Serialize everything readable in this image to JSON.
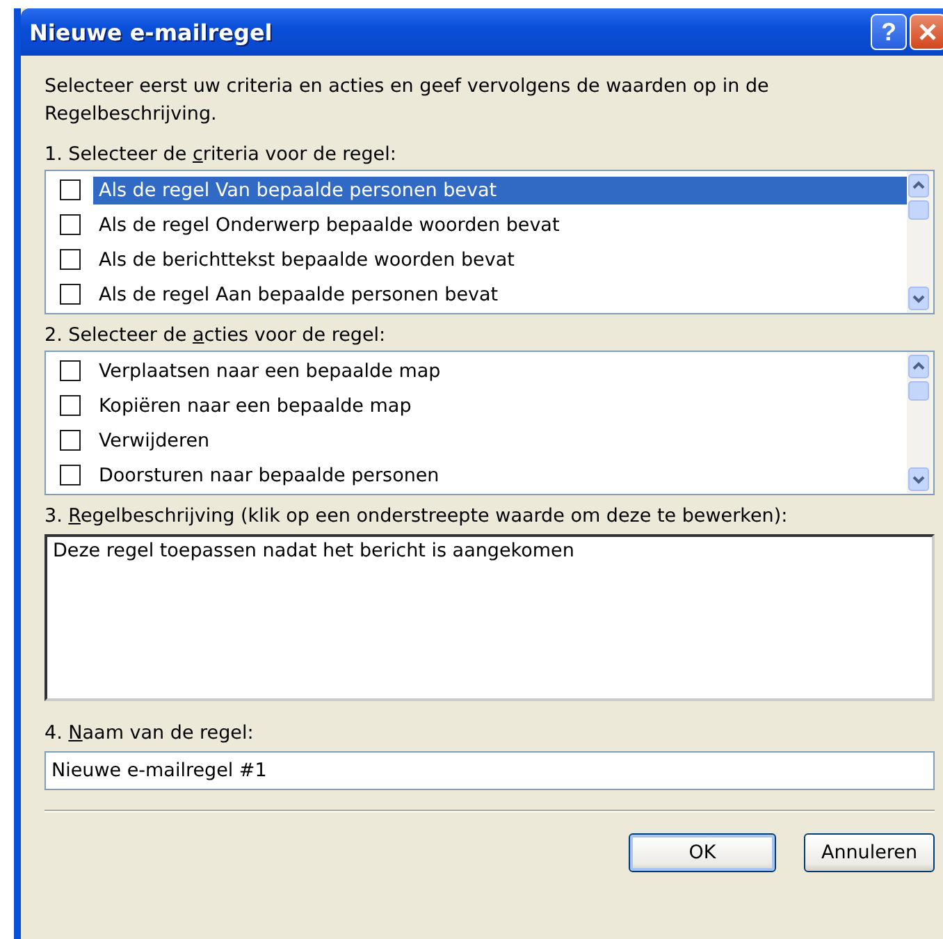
{
  "window": {
    "title": "Nieuwe e-mailregel",
    "help_button": "?"
  },
  "intro": "Selecteer eerst uw criteria en acties en geef vervolgens de waarden op in de Regelbeschrijving.",
  "criteria": {
    "label": {
      "prefix": "1. Selecteer de ",
      "key": "c",
      "suffix": "riteria voor de regel:"
    },
    "items": [
      {
        "label": "Als de regel Van bepaalde personen bevat",
        "checked": false,
        "selected": true
      },
      {
        "label": "Als de regel Onderwerp bepaalde woorden bevat",
        "checked": false,
        "selected": false
      },
      {
        "label": "Als de berichttekst bepaalde woorden bevat",
        "checked": false,
        "selected": false
      },
      {
        "label": "Als de regel Aan bepaalde personen bevat",
        "checked": false,
        "selected": false
      }
    ]
  },
  "actions": {
    "label": {
      "prefix": "2. Selecteer de ",
      "key": "a",
      "suffix": "cties voor de regel:"
    },
    "items": [
      {
        "label": "Verplaatsen naar een bepaalde map",
        "checked": false,
        "selected": false
      },
      {
        "label": "Kopiëren naar een bepaalde map",
        "checked": false,
        "selected": false
      },
      {
        "label": "Verwijderen",
        "checked": false,
        "selected": false
      },
      {
        "label": "Doorsturen naar bepaalde personen",
        "checked": false,
        "selected": false
      }
    ]
  },
  "description": {
    "label": {
      "prefix": "3. ",
      "key": "R",
      "suffix": "egelbeschrijving (klik op een onderstreepte waarde om deze te bewerken):"
    },
    "text": "Deze regel toepassen nadat het bericht is aangekomen"
  },
  "name": {
    "label": {
      "prefix": "4. ",
      "key": "N",
      "suffix": "aam van de regel:"
    },
    "value": "Nieuwe e-mailregel #1"
  },
  "buttons": [
    {
      "label": "OK",
      "default": true
    },
    {
      "label": "Annuleren",
      "default": false
    }
  ]
}
